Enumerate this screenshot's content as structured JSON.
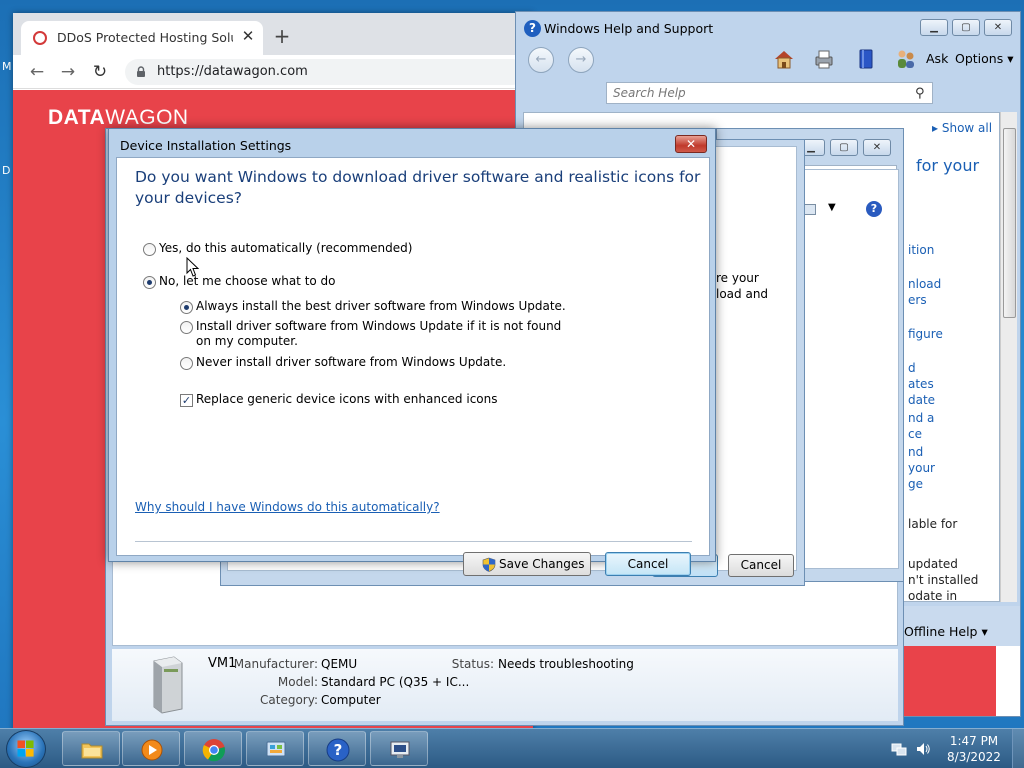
{
  "desktop": {
    "glyph_top": "M",
    "glyph_mid": "D"
  },
  "browser": {
    "tab_title": "DDoS Protected Hosting Solutio",
    "url": "https://datawagon.com",
    "site_logo_bold": "DATA",
    "site_logo_light": "WAGON"
  },
  "help": {
    "title": "Windows Help and Support",
    "ask": "Ask",
    "options": "Options",
    "search_placeholder": "Search Help",
    "show_all": "Show all",
    "heading": "for your",
    "links": [
      "ition",
      "nload",
      "ers",
      "figure",
      "d",
      "ates",
      "date",
      "nd a",
      "ce",
      "nd",
      "your",
      "ge"
    ],
    "text_lines": [
      "lable for",
      "updated",
      "n't installed",
      "odate in"
    ],
    "offline_help": "Offline Help"
  },
  "middle_dialog": {
    "cancel": "Cancel",
    "partial_text": [
      "re your",
      "load and"
    ]
  },
  "devices": {
    "name": "VM1",
    "manufacturer_label": "Manufacturer:",
    "manufacturer": "QEMU",
    "model_label": "Model:",
    "model": "Standard PC (Q35 + IC...",
    "category_label": "Category:",
    "category": "Computer",
    "status_label": "Status:",
    "status": "Needs troubleshooting"
  },
  "dialog": {
    "title": "Device Installation Settings",
    "question": "Do you want Windows to download driver software and realistic icons for your devices?",
    "option_auto": "Yes, do this automatically (recommended)",
    "option_manual": "No, let me choose what to do",
    "sub_always": "Always install the best driver software from Windows Update.",
    "sub_if_not_found": "Install driver software from Windows Update if it is not found on my computer.",
    "sub_never": "Never install driver software from Windows Update.",
    "replace_icons": "Replace generic device icons with enhanced icons",
    "why_link": "Why should I have Windows do this automatically?",
    "save": "Save Changes",
    "cancel": "Cancel",
    "close_glyph": "✕",
    "selected_option": "No, let me choose what to do",
    "selected_sub_option": "Always install the best driver software from Windows Update.",
    "replace_icons_checked": true
  },
  "taskbar": {
    "time": "1:47 PM",
    "date": "8/3/2022"
  }
}
